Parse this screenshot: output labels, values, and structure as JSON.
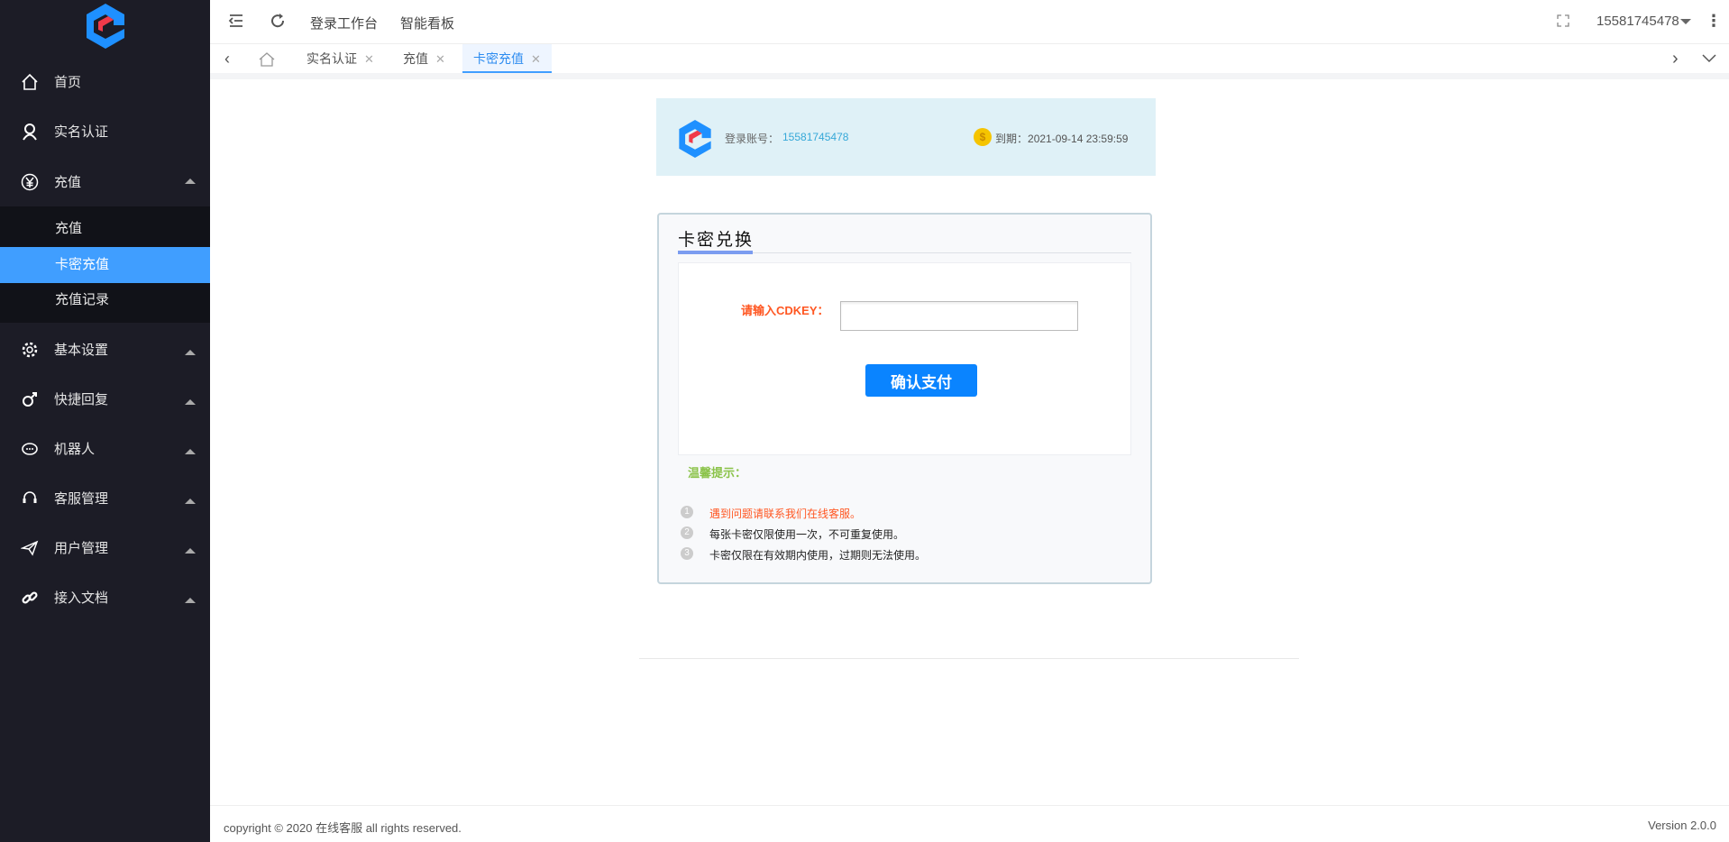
{
  "sidebar": {
    "items": [
      {
        "label": "首页",
        "icon": "home-icon"
      },
      {
        "label": "实名认证",
        "icon": "user-icon"
      },
      {
        "label": "充值",
        "icon": "yen-icon"
      },
      {
        "label": "基本设置",
        "icon": "gear-icon"
      },
      {
        "label": "快捷回复",
        "icon": "quick-reply-icon"
      },
      {
        "label": "机器人",
        "icon": "robot-icon"
      },
      {
        "label": "客服管理",
        "icon": "headset-icon"
      },
      {
        "label": "用户管理",
        "icon": "send-icon"
      },
      {
        "label": "接入文档",
        "icon": "link-icon"
      }
    ],
    "submenu": [
      "充值",
      "卡密充值",
      "充值记录"
    ]
  },
  "header": {
    "links": [
      "登录工作台",
      "智能看板"
    ],
    "username": "15581745478"
  },
  "tabs": [
    "实名认证",
    "充值",
    "卡密充值"
  ],
  "banner": {
    "account_label": "登录账号：",
    "account": "15581745478",
    "expire_label": "到期：",
    "expire": "2021-09-14 23:59:59"
  },
  "card": {
    "title": "卡密兑换",
    "input_label": "请输入CDKEY：",
    "input_value": "",
    "submit": "确认支付",
    "tips_title": "温馨提示：",
    "tips": [
      {
        "n": "1",
        "text": "遇到问题请联系我们在线客服。"
      },
      {
        "n": "2",
        "text": "每张卡密仅限使用一次，不可重复使用。"
      },
      {
        "n": "3",
        "text": "卡密仅限在有效期内使用，过期则无法使用。"
      }
    ]
  },
  "footer": {
    "copyright": "copyright © 2020 在线客服 all rights reserved.",
    "version": "Version 2.0.0"
  },
  "colors": {
    "accent": "#409eff",
    "sidebar": "#1c1c26",
    "warn": "#ff5722",
    "tip": "#8bc34a",
    "button": "#0a84ff"
  }
}
